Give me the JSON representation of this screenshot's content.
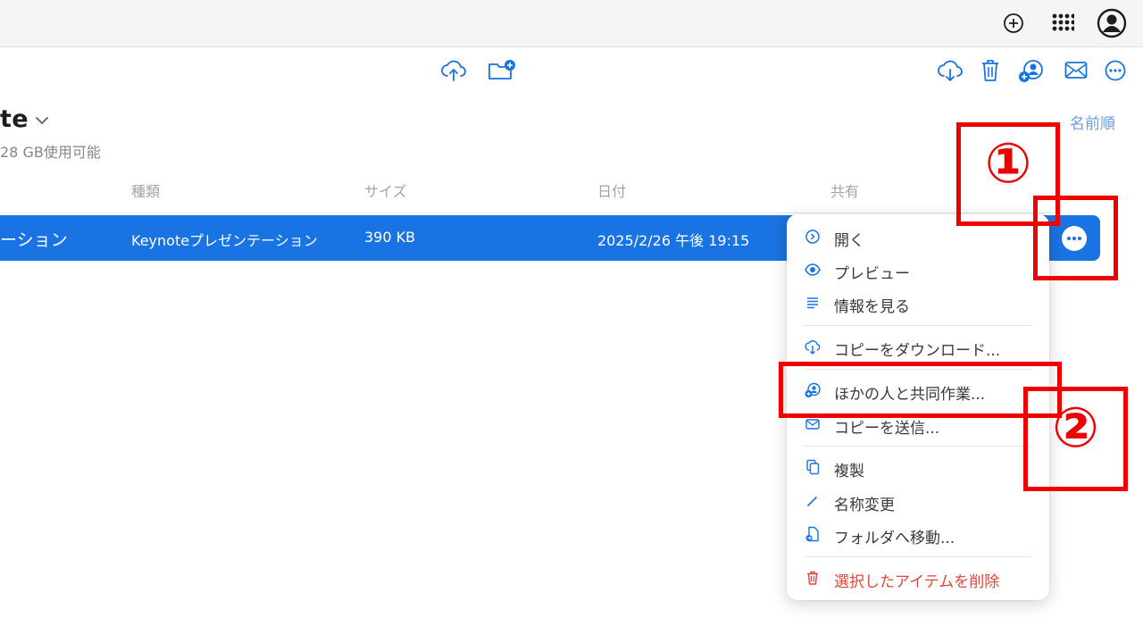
{
  "topbar": {
    "icons": [
      "add-circle-icon",
      "app-grid-icon",
      "account-icon"
    ]
  },
  "toolbar": {
    "center_icons": [
      "upload-icon",
      "new-folder-icon"
    ],
    "right_icons": [
      "download-icon",
      "trash-icon",
      "share-collaborate-icon",
      "mail-icon",
      "more-icon"
    ]
  },
  "folder": {
    "title": "te",
    "storage": "28 GB使用可能",
    "sort_label": "名前順"
  },
  "table": {
    "columns": [
      "種類",
      "サイズ",
      "日付",
      "共有"
    ],
    "selected_row": {
      "name": "ーション",
      "kind": "Keynoteプレゼンテーション",
      "size": "390 KB",
      "date": "2025/2/26 午後 19:15"
    }
  },
  "context_menu": {
    "groups": [
      [
        {
          "icon": "chevron-circle-icon",
          "label": "開く"
        },
        {
          "icon": "eye-icon",
          "label": "プレビュー"
        },
        {
          "icon": "info-lines-icon",
          "label": "情報を見る"
        }
      ],
      [
        {
          "icon": "cloud-download-icon",
          "label": "コピーをダウンロード..."
        }
      ],
      [
        {
          "icon": "collaborate-icon",
          "label": "ほかの人と共同作業..."
        },
        {
          "icon": "envelope-icon",
          "label": "コピーを送信..."
        }
      ],
      [
        {
          "icon": "duplicate-icon",
          "label": "複製"
        },
        {
          "icon": "pencil-icon",
          "label": "名称変更"
        },
        {
          "icon": "move-to-folder-icon",
          "label": "フォルダへ移動..."
        }
      ],
      [
        {
          "icon": "trash-icon",
          "label": "選択したアイテムを削除",
          "danger": true
        }
      ]
    ]
  },
  "annotations": {
    "step1": "①",
    "step2": "②",
    "color": "#ee0000"
  },
  "colors": {
    "accent": "#1a73e2",
    "danger": "#e0453a",
    "annotation": "#ee0000"
  }
}
